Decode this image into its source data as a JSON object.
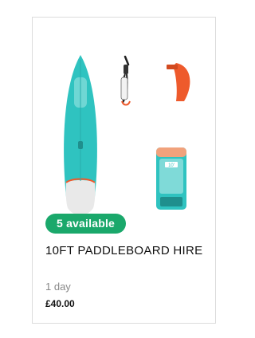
{
  "product": {
    "availability_badge": "5 available",
    "title": "10FT PADDLEBOARD HIRE",
    "duration": "1 day",
    "price": "£40.00",
    "image": {
      "items": [
        "paddleboard",
        "leash",
        "fin",
        "carry-bag"
      ],
      "colors": {
        "board": "#2fc3c0",
        "accent": "#ee5a2c",
        "badge": "#1aa86b"
      }
    },
    "bag_label": "10'"
  }
}
